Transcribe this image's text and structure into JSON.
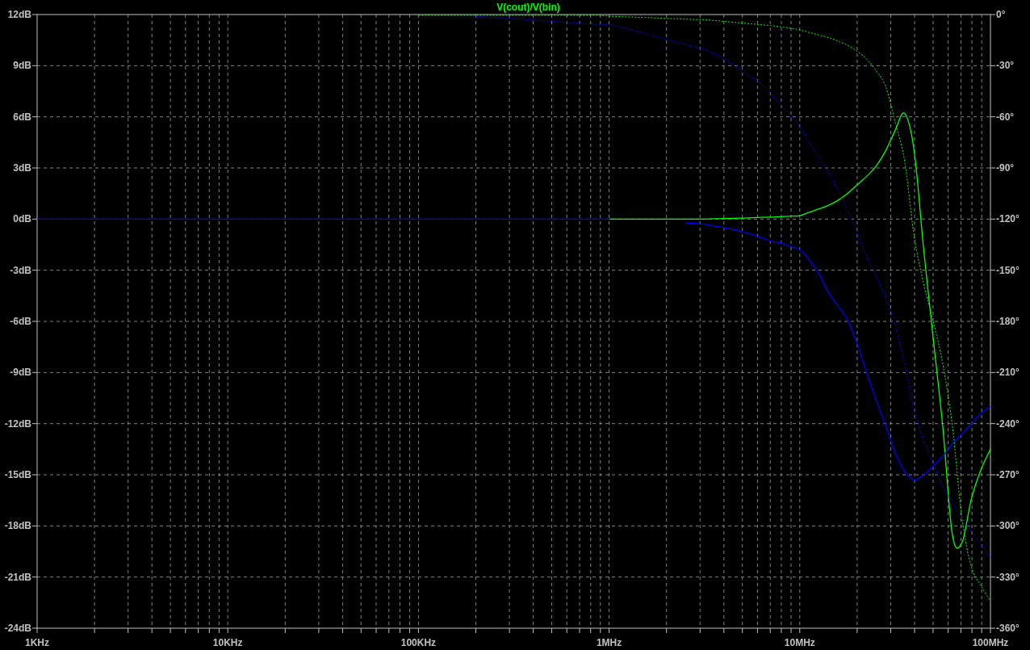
{
  "magnitude_plot": {
    "chart_data": {
      "type": "line",
      "title": "V(cout)/V(bin)",
      "grid": true,
      "categories": [
        "1KHz",
        null,
        null,
        null,
        null,
        null,
        null,
        null,
        null,
        null,
        null,
        null,
        null,
        null,
        null,
        null,
        null,
        null,
        null,
        null,
        "10KHz",
        null,
        null,
        null,
        null,
        null,
        null,
        null,
        null,
        null,
        null,
        null,
        null,
        null,
        null,
        null,
        null,
        null,
        null,
        null,
        "100KHz",
        null,
        null,
        null,
        null,
        null,
        null,
        null,
        null,
        null,
        null,
        null,
        null,
        null,
        null,
        null,
        null,
        null,
        null,
        null,
        "1MHz",
        null,
        null,
        null,
        null,
        null,
        null,
        null,
        null,
        null,
        null,
        null,
        null,
        null,
        null,
        null,
        null,
        null,
        null,
        null,
        "10MHz",
        null,
        null,
        null,
        null,
        null,
        null,
        null,
        null,
        null,
        null,
        null,
        null,
        null,
        null,
        null,
        null,
        null,
        null,
        null,
        "100MHz"
      ],
      "ylim": [
        -24,
        12
      ],
      "yticks": [
        {
          "value": 12,
          "label": "12dB"
        },
        {
          "value": 9,
          "label": "9dB"
        },
        {
          "value": 6,
          "label": "6dB"
        },
        {
          "value": 3,
          "label": "3dB"
        },
        {
          "value": 0,
          "label": "0dB"
        },
        {
          "value": -3,
          "label": "-3dB"
        },
        {
          "value": -6,
          "label": "-6dB"
        },
        {
          "value": -9,
          "label": "-9dB"
        },
        {
          "value": -12,
          "label": "-12dB"
        },
        {
          "value": -15,
          "label": "-15dB"
        },
        {
          "value": -18,
          "label": "-18dB"
        },
        {
          "value": -21,
          "label": "-21dB"
        },
        {
          "value": -24,
          "label": "-24dB"
        }
      ],
      "series": [
        {
          "color": "#00ff00",
          "line_style": "solid",
          "values": [
            null,
            null,
            null,
            null,
            null,
            null,
            null,
            null,
            null,
            null,
            null,
            null,
            null,
            null,
            null,
            null,
            null,
            null,
            null,
            null,
            null,
            null,
            null,
            null,
            null,
            null,
            null,
            null,
            null,
            null,
            null,
            null,
            null,
            null,
            null,
            null,
            null,
            null,
            null,
            null,
            null,
            null,
            null,
            null,
            null,
            null,
            null,
            null,
            null,
            null,
            null,
            null,
            null,
            null,
            null,
            null,
            null,
            null,
            null,
            null,
            0,
            0,
            0,
            0,
            0,
            0,
            0,
            0,
            0,
            0,
            0,
            0.02,
            0.03,
            0.05,
            0.06,
            0.08,
            0.1,
            0.12,
            0.14,
            0.17,
            0.2,
            0.4,
            0.6,
            0.8,
            1.1,
            1.5,
            2.0,
            2.5,
            3.1,
            4.0,
            5.2,
            6.2,
            4.0,
            -1.8,
            -7.0,
            -12.2,
            -18.5,
            -19.0,
            -16.4,
            -14.7,
            -13.5
          ]
        },
        {
          "color": "#0000ff",
          "line_style": "solid",
          "values": [
            0,
            0,
            0,
            0,
            0,
            0,
            0,
            0,
            0,
            0,
            0,
            0,
            0,
            0,
            0,
            0,
            0,
            0,
            0,
            0,
            0,
            0,
            0,
            0,
            0,
            0,
            0,
            0,
            0,
            0,
            0,
            0,
            0,
            0,
            0,
            0,
            0,
            0,
            0,
            0,
            0,
            0,
            0,
            0,
            0,
            0,
            0,
            0,
            0,
            0,
            0,
            0,
            0,
            0,
            0,
            0,
            0,
            0,
            0,
            0,
            0,
            null,
            null,
            null,
            null,
            null,
            null,
            null,
            -0.22,
            -0.25,
            -0.3,
            -0.4,
            -0.5,
            -0.6,
            -0.75,
            -0.9,
            -1.1,
            -1.3,
            -1.4,
            -1.6,
            -1.8,
            -2.4,
            -3.2,
            -4.3,
            -5.1,
            -5.9,
            -7.3,
            -9.0,
            -10.6,
            -12.1,
            -13.7,
            -14.8,
            -15.3,
            -15.0,
            -14.5,
            -13.9,
            -13.2,
            -12.6,
            -12.0,
            -11.4,
            -11.0
          ]
        }
      ]
    }
  },
  "phase_plot": {
    "chart_data": {
      "type": "line",
      "ylim": [
        -360,
        0
      ],
      "yticks": [
        {
          "value": 0,
          "label": "0°"
        },
        {
          "value": -30,
          "label": "-30°"
        },
        {
          "value": -60,
          "label": "-60°"
        },
        {
          "value": -90,
          "label": "-90°"
        },
        {
          "value": -120,
          "label": "-120°"
        },
        {
          "value": -150,
          "label": "-150°"
        },
        {
          "value": -180,
          "label": "-180°"
        },
        {
          "value": -210,
          "label": "-210°"
        },
        {
          "value": -240,
          "label": "-240°"
        },
        {
          "value": -270,
          "label": "-270°"
        },
        {
          "value": -300,
          "label": "-300°"
        },
        {
          "value": -330,
          "label": "-330°"
        },
        {
          "value": -360,
          "label": "-360°"
        }
      ],
      "series": [
        {
          "color": "#00ff00",
          "line_style": "dashed",
          "values": [
            null,
            null,
            null,
            null,
            null,
            null,
            null,
            null,
            null,
            null,
            null,
            null,
            null,
            null,
            null,
            null,
            null,
            null,
            null,
            null,
            null,
            null,
            null,
            null,
            null,
            null,
            null,
            null,
            null,
            null,
            null,
            null,
            null,
            null,
            null,
            null,
            null,
            null,
            null,
            null,
            -0.5,
            -0.5,
            -0.5,
            -0.5,
            -0.5,
            -0.5,
            -0.5,
            -0.5,
            -0.5,
            -0.5,
            -0.5,
            -0.5,
            -0.5,
            -0.5,
            -0.5,
            -0.5,
            -0.5,
            -0.5,
            -0.5,
            -0.5,
            -1,
            -1.2,
            -1.4,
            -1.6,
            -1.8,
            -2,
            -2.3,
            -2.5,
            -2.7,
            -2.9,
            -3,
            -3.5,
            -4,
            -4.5,
            -5,
            -5.5,
            -6,
            -6.5,
            -7.2,
            -8,
            -9,
            -10.5,
            -12,
            -13.5,
            -15.5,
            -18,
            -21.5,
            -26,
            -33,
            -42,
            -63,
            -86,
            -130,
            -158,
            -180,
            -205,
            -241,
            -295,
            -324,
            -335,
            -344
          ]
        },
        {
          "color": "#0000ff",
          "line_style": "dashed",
          "values": [
            null,
            null,
            null,
            null,
            null,
            null,
            null,
            null,
            null,
            null,
            null,
            null,
            null,
            null,
            null,
            null,
            null,
            null,
            null,
            null,
            null,
            null,
            null,
            null,
            null,
            null,
            null,
            null,
            null,
            null,
            null,
            null,
            null,
            null,
            null,
            null,
            null,
            null,
            null,
            null,
            null,
            null,
            null,
            null,
            null,
            null,
            -1.1,
            -1.4,
            -1.7,
            -2,
            -2.4,
            -2.8,
            -3.2,
            -3.6,
            -4,
            -4.4,
            -4.8,
            -5.2,
            -5.5,
            -5.8,
            -6,
            -7,
            -8.5,
            -10,
            -11.5,
            -13,
            -14.5,
            -16,
            -17.5,
            -19,
            -20.5,
            -23,
            -26,
            -29,
            -33,
            -37,
            -41,
            -47,
            -53,
            -59,
            -66,
            -75,
            -84,
            -93,
            -103,
            -115,
            -128,
            -142,
            -153,
            -166,
            -182,
            -205,
            -232,
            -250,
            -263,
            -277,
            -286,
            -295,
            -303,
            -311,
            -318
          ]
        }
      ]
    }
  }
}
